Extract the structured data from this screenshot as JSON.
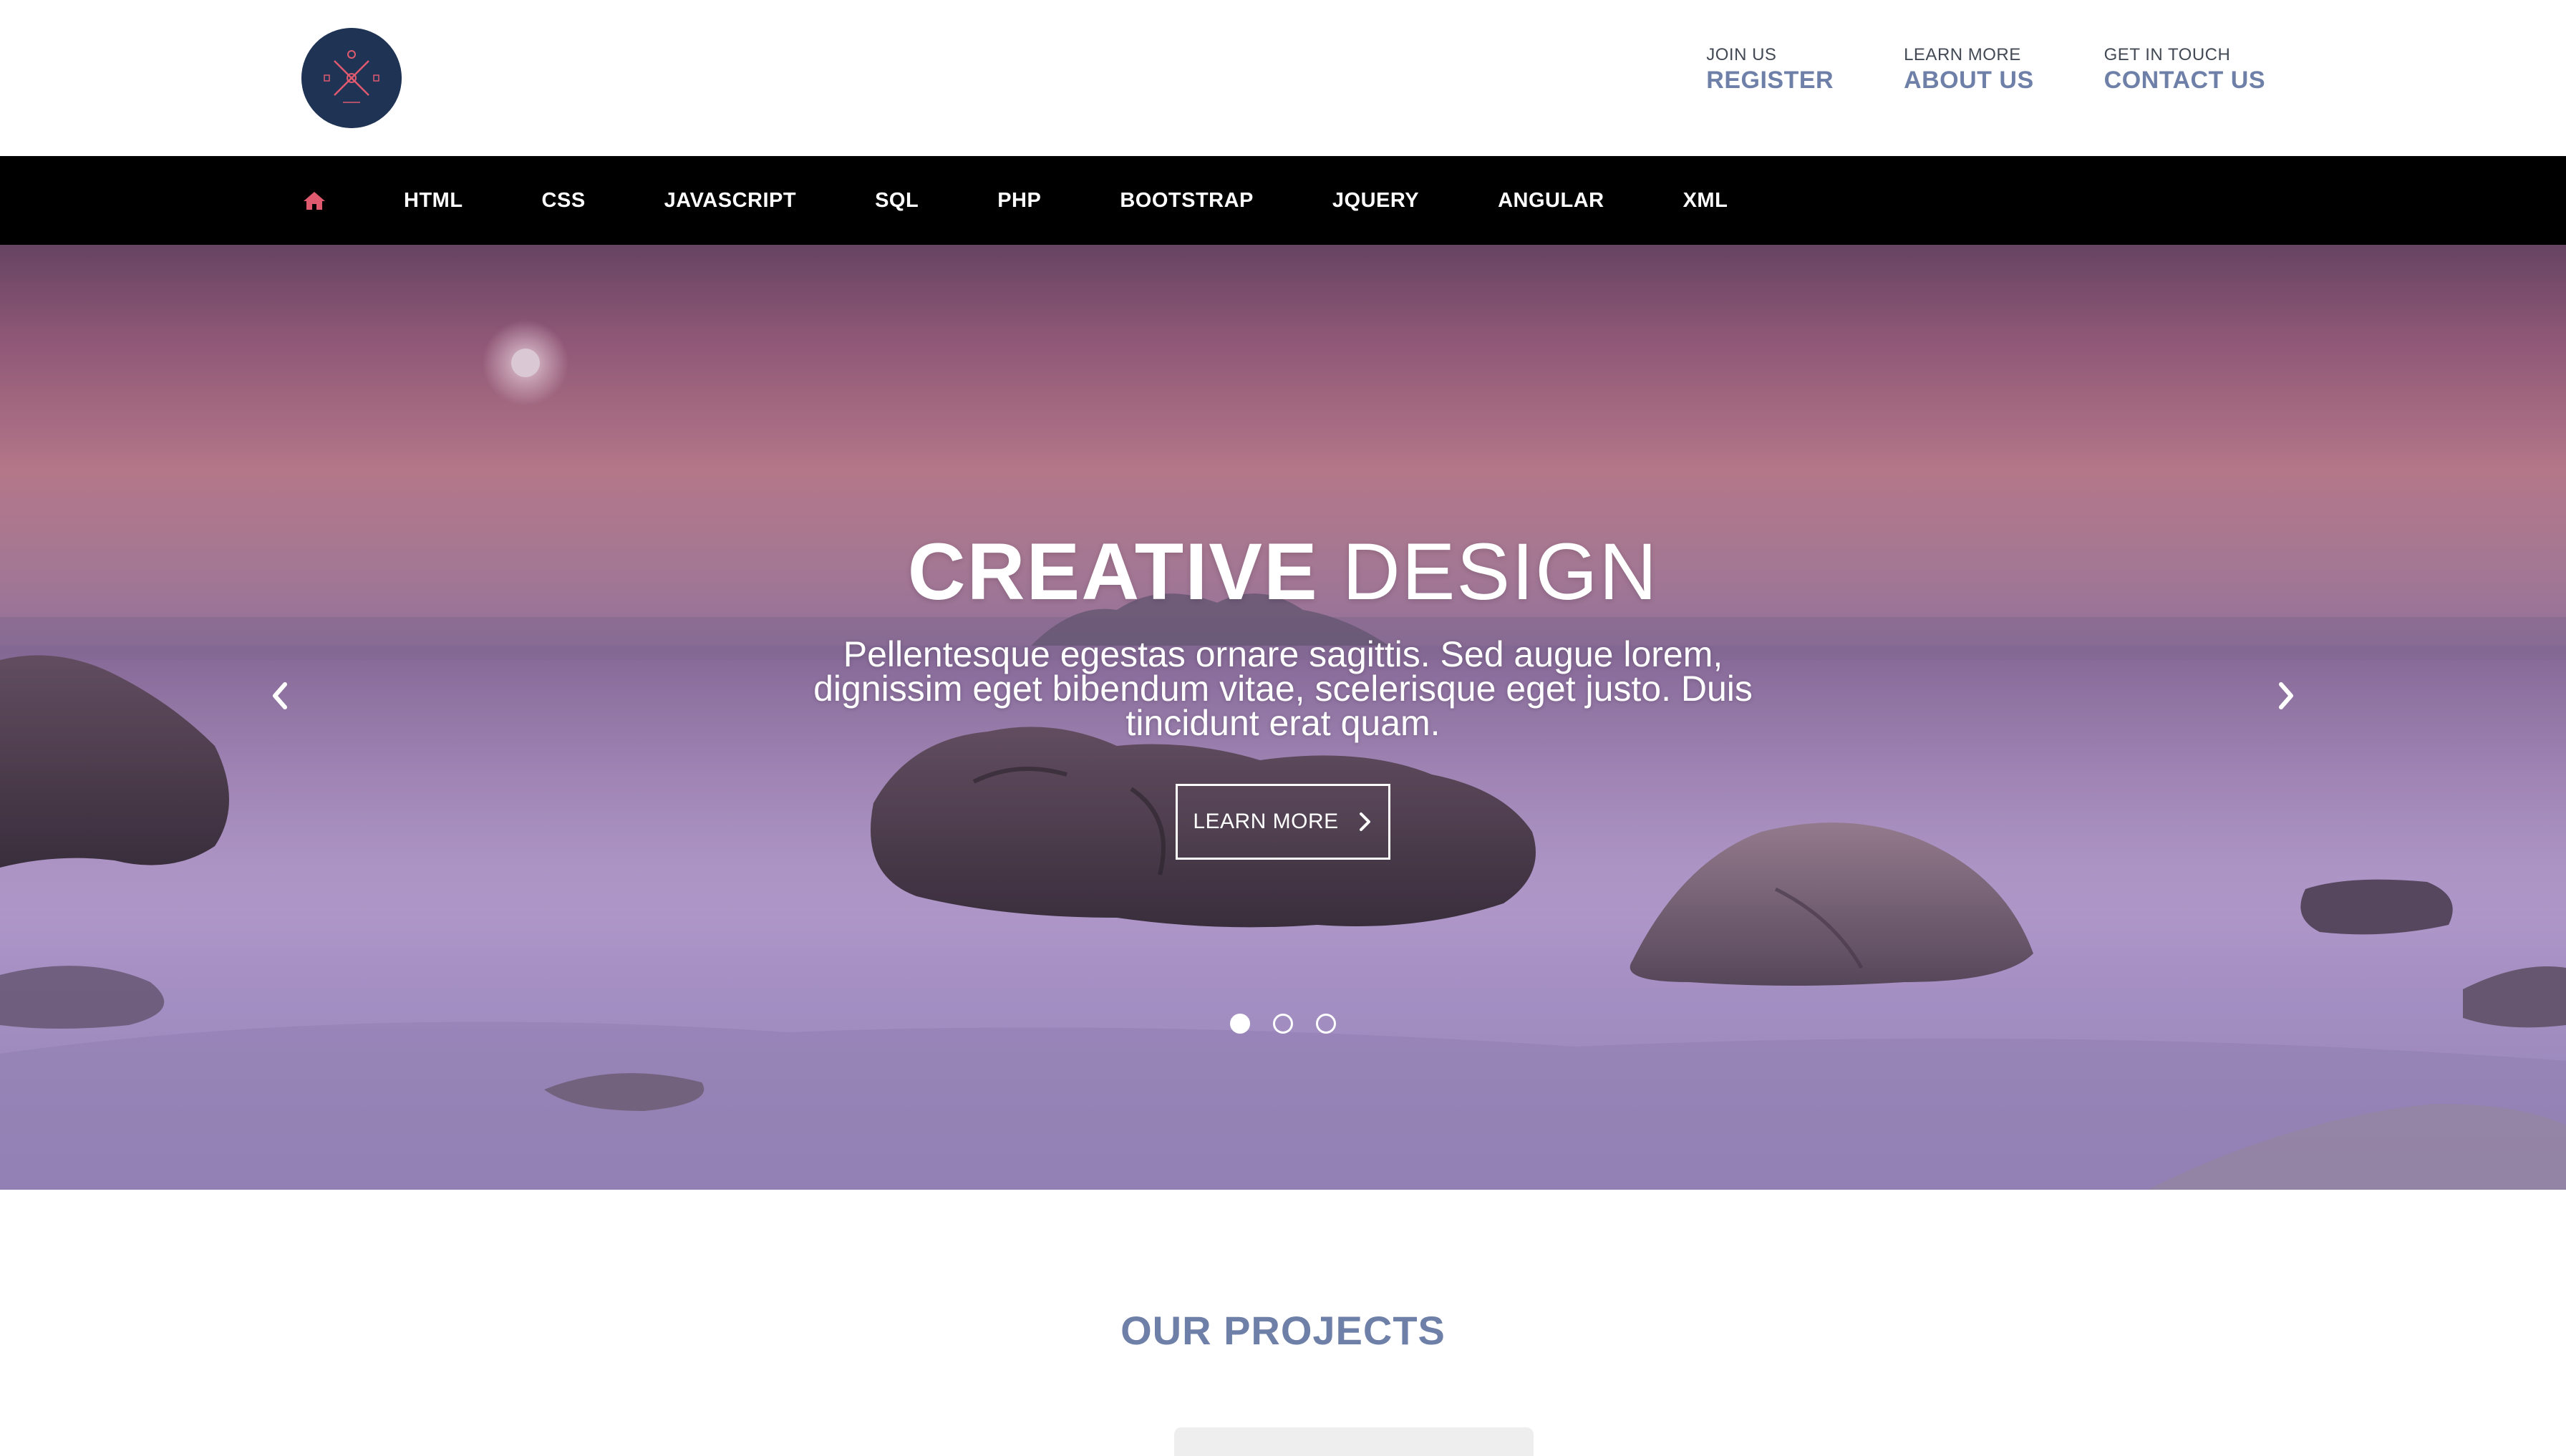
{
  "header": {
    "links": [
      {
        "small": "JOIN US",
        "big": "REGISTER"
      },
      {
        "small": "LEARN MORE",
        "big": "ABOUT US"
      },
      {
        "small": "GET IN TOUCH",
        "big": "CONTACT US"
      }
    ]
  },
  "nav": {
    "home_icon": "home-icon",
    "items": [
      "HTML",
      "CSS",
      "JAVASCRIPT",
      "SQL",
      "PHP",
      "BOOTSTRAP",
      "JQUERY",
      "ANGULAR",
      "XML"
    ]
  },
  "hero": {
    "title_strong": "CREATIVE",
    "title_light": "DESIGN",
    "subtitle": "Pellentesque egestas ornare sagittis. Sed augue lorem, dignissim eget bibendum vitae, scelerisque eget justo. Duis tincidunt erat quam.",
    "button_label": "LEARN MORE",
    "slides_count": 3,
    "active_slide": 1
  },
  "projects": {
    "title": "OUR PROJECTS"
  },
  "colors": {
    "accent": "#6f80a8",
    "logo_bg": "#1f3355",
    "home_icon": "#e05a6f",
    "navbar": "#000000"
  }
}
